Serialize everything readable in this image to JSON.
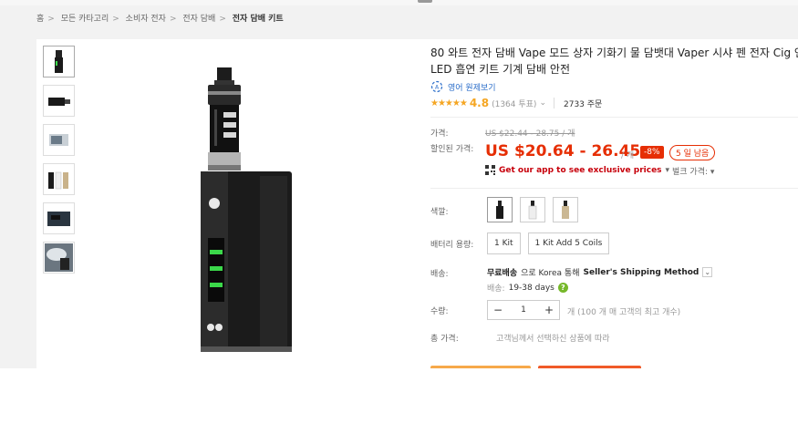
{
  "breadcrumb": {
    "items": [
      "홈",
      "모든 카타고리",
      "소비자 전자",
      "전자 담배"
    ],
    "current": "전자 담배 키트"
  },
  "product": {
    "title_line1": "80 와트 전자 담배 Vape 모드 상자 기화기 물 담뱃대 Vaper 시샤 펜 전자 Cig 연",
    "title_line2": "LED 흡연 키트 기계 담배 안전",
    "translate_label": "영어 원제보기",
    "stars": "★★★★★",
    "score": "4.8",
    "votes": "(1364 투표)",
    "orders": "2733 주문"
  },
  "price": {
    "label_price": "가격:",
    "old": "US $22.44 - 28.75 / 개",
    "label_discount": "할인된 가격:",
    "new": "US $20.64 - 26.45",
    "per_unit": "/ 개",
    "discount_badge": "-8%",
    "days_left": "5 일 남음",
    "app_promo": "Get our app to see exclusive prices",
    "bulk": "벌크 가격:"
  },
  "color": {
    "label": "색깔:",
    "swatches": [
      "black",
      "white",
      "silver"
    ]
  },
  "battery": {
    "label": "배터리 용량:",
    "options": [
      "1 Kit",
      "1 Kit Add 5 Coils"
    ]
  },
  "shipping": {
    "label": "배송:",
    "free": "무료배송",
    "via": "으로 Korea 통해",
    "method": "Seller's Shipping Method",
    "delivery_label": "배송:",
    "delivery_days": "19-38 days"
  },
  "quantity": {
    "label": "수량:",
    "minus": "−",
    "value": "1",
    "plus": "+",
    "note": "개 (100 개 매 고객의 최고 개수)"
  },
  "total": {
    "label": "총 가격:",
    "note": "고객님께서 선택하신 상품에 따라"
  },
  "device_screen": {
    "brand": "BIGBOX",
    "model": "MINI",
    "w1": "80W",
    "w2": "65W",
    "w3": "40W"
  },
  "colors": {
    "price_red": "#e62e04",
    "star_orange": "#f5a623",
    "link_blue": "#2a6dc9",
    "screen_green": "#3bd84a"
  }
}
